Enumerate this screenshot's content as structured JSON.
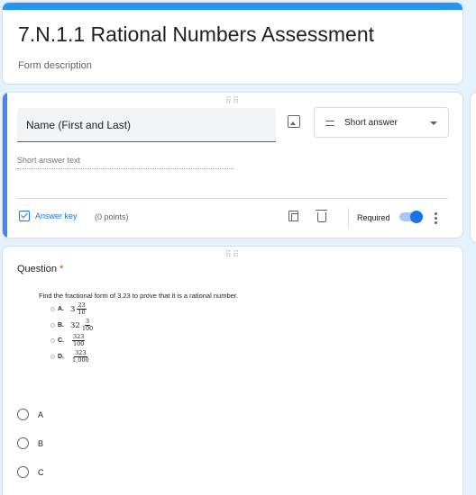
{
  "form": {
    "title": "7.N.1.1 Rational Numbers Assessment",
    "description": "Form description"
  },
  "question1": {
    "title": "Name (First and Last)",
    "type_label": "Short answer",
    "short_answer_placeholder": "Short answer text",
    "answer_key_label": "Answer key",
    "points_label": "(0 points)",
    "required_label": "Required",
    "required_on": true
  },
  "question2": {
    "label": "Question",
    "required_star": "*",
    "prompt": "Find the fractional form of 3.23 to prove that it is a rational number.",
    "embedded_choices": [
      {
        "letter": "A.",
        "whole": "3",
        "num": "23",
        "den": "10"
      },
      {
        "letter": "B.",
        "whole": "32",
        "num": "3",
        "den": "100"
      },
      {
        "letter": "C.",
        "whole": "",
        "num": "323",
        "den": "100"
      },
      {
        "letter": "D.",
        "whole": "",
        "num": "323",
        "den": "1,000"
      }
    ],
    "options": [
      "A",
      "B",
      "C"
    ]
  },
  "colors": {
    "accent": "#2196f3",
    "active_bar": "#4285f4",
    "required_star": "#d93025",
    "background": "#e3f2fd"
  },
  "icons": [
    "image-icon",
    "short-answer-icon",
    "dropdown-caret-icon",
    "checkbox-icon",
    "copy-icon",
    "trash-icon",
    "more-vert-icon"
  ]
}
